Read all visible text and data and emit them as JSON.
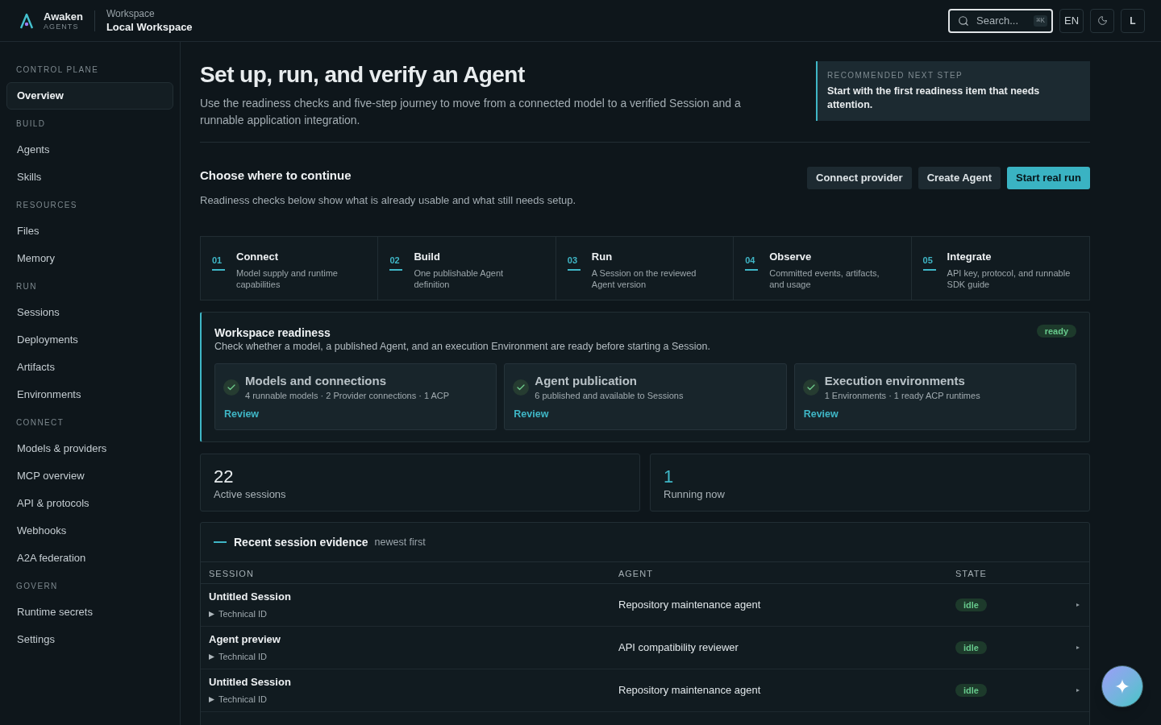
{
  "brand": {
    "name": "Awaken",
    "tagline": "AGENTS"
  },
  "workspace": {
    "label": "Workspace",
    "name": "Local Workspace"
  },
  "search": {
    "placeholder": "Search...",
    "shortcut": "⌘K"
  },
  "language": "EN",
  "user_initial": "L",
  "sidebar": [
    {
      "heading": "CONTROL PLANE",
      "items": [
        {
          "label": "Overview",
          "selected": true
        }
      ]
    },
    {
      "heading": "BUILD",
      "items": [
        {
          "label": "Agents",
          "selected": false
        },
        {
          "label": "Skills",
          "selected": false
        }
      ]
    },
    {
      "heading": "RESOURCES",
      "items": [
        {
          "label": "Files",
          "selected": false
        },
        {
          "label": "Memory",
          "selected": false
        }
      ]
    },
    {
      "heading": "RUN",
      "items": [
        {
          "label": "Sessions",
          "selected": false
        },
        {
          "label": "Deployments",
          "selected": false
        },
        {
          "label": "Artifacts",
          "selected": false
        },
        {
          "label": "Environments",
          "selected": false
        }
      ]
    },
    {
      "heading": "CONNECT",
      "items": [
        {
          "label": "Models & providers",
          "selected": false
        },
        {
          "label": "MCP overview",
          "selected": false
        },
        {
          "label": "API & protocols",
          "selected": false
        },
        {
          "label": "Webhooks",
          "selected": false
        },
        {
          "label": "A2A federation",
          "selected": false
        }
      ]
    },
    {
      "heading": "GOVERN",
      "items": [
        {
          "label": "Runtime secrets",
          "selected": false
        },
        {
          "label": "Settings",
          "selected": false
        }
      ]
    }
  ],
  "hero": {
    "title": "Set up, run, and verify an Agent",
    "description": "Use the readiness checks and five-step journey to move from a connected model to a verified Session and a runnable application integration."
  },
  "recommendation": {
    "label": "RECOMMENDED NEXT STEP",
    "text": "Start with the first readiness item that needs attention."
  },
  "continue": {
    "title": "Choose where to continue",
    "description": "Readiness checks below show what is already usable and what still needs setup.",
    "actions": [
      {
        "label": "Connect provider",
        "kind": "secondary"
      },
      {
        "label": "Create Agent",
        "kind": "secondary"
      },
      {
        "label": "Start real run",
        "kind": "primary"
      }
    ]
  },
  "steps": [
    {
      "number": "01",
      "title": "Connect",
      "description": "Model supply and runtime capabilities"
    },
    {
      "number": "02",
      "title": "Build",
      "description": "One publishable Agent definition"
    },
    {
      "number": "03",
      "title": "Run",
      "description": "A Session on the reviewed Agent version"
    },
    {
      "number": "04",
      "title": "Observe",
      "description": "Committed events, artifacts, and usage"
    },
    {
      "number": "05",
      "title": "Integrate",
      "description": "API key, protocol, and runnable SDK guide"
    }
  ],
  "readiness": {
    "title": "Workspace readiness",
    "description": "Check whether a model, a published Agent, and an execution Environment are ready before starting a Session.",
    "status": "ready",
    "checks": [
      {
        "title": "Models and connections",
        "detail": "4 runnable models · 2 Provider connections · 1 ACP",
        "action": "Review",
        "passed": true
      },
      {
        "title": "Agent publication",
        "detail": "6 published and available to Sessions",
        "action": "Review",
        "passed": true
      },
      {
        "title": "Execution environments",
        "detail": "1 Environments · 1 ready ACP runtimes",
        "action": "Review",
        "passed": true
      }
    ]
  },
  "stats": [
    {
      "value": "22",
      "label": "Active sessions",
      "kind": "total"
    },
    {
      "value": "1",
      "label": "Running now",
      "kind": "live"
    }
  ],
  "sessions": {
    "title": "Recent session evidence",
    "subtitle": "newest first",
    "columns": [
      "SESSION",
      "AGENT",
      "STATE"
    ],
    "rows": [
      {
        "session": "Untitled Session",
        "detail": "Technical ID",
        "expanded": false,
        "agent": "Repository maintenance agent",
        "state": "idle"
      },
      {
        "session": "Agent preview",
        "detail": "Technical ID",
        "expanded": false,
        "agent": "API compatibility reviewer",
        "state": "idle"
      },
      {
        "session": "Untitled Session",
        "detail": "Technical ID",
        "expanded": false,
        "agent": "Repository maintenance agent",
        "state": "idle"
      }
    ]
  }
}
